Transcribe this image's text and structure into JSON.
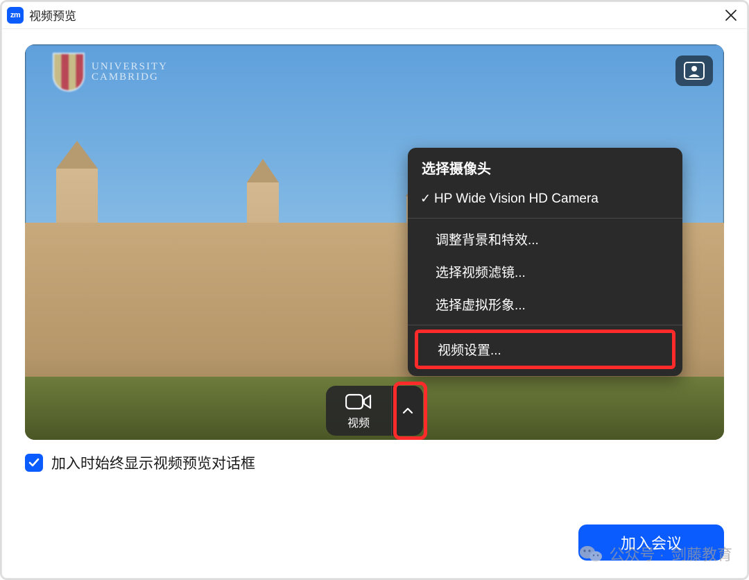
{
  "title_bar": {
    "logo_text": "zm",
    "title": "视频预览"
  },
  "preview": {
    "crest_line1": "UNIVERSITY",
    "crest_line2": "CAMBRIDG",
    "video_label": "视频"
  },
  "camera_menu": {
    "header": "选择摄像头",
    "camera_option": "HP Wide Vision HD Camera",
    "adjust_bg": "调整背景和特效...",
    "choose_filter": "选择视频滤镜...",
    "choose_avatar": "选择虚拟形象...",
    "video_settings": "视频设置..."
  },
  "checkbox": {
    "label": "加入时始终显示视频预览对话框"
  },
  "join_button_label": "加入会议",
  "watermark": {
    "prefix": "公众号 · ",
    "name": "剑藤教育"
  }
}
